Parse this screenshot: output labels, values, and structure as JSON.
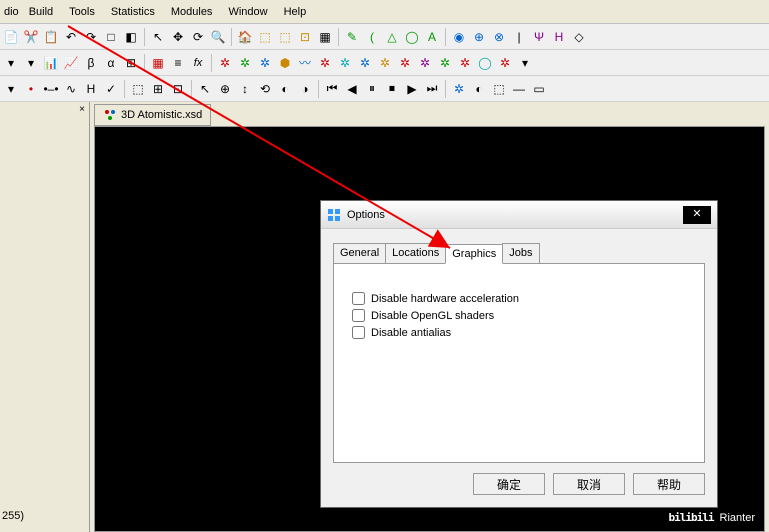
{
  "menubar": {
    "items": [
      "Build",
      "Tools",
      "Statistics",
      "Modules",
      "Window",
      "Help"
    ],
    "title_partial": "dio"
  },
  "document": {
    "tab_title": "3D Atomistic.xsd"
  },
  "sidebar": {
    "bottom_text": "255)"
  },
  "dialog": {
    "title": "Options",
    "tabs": [
      "General",
      "Locations",
      "Graphics",
      "Jobs"
    ],
    "active_tab": 2,
    "options": [
      {
        "label": "Disable hardware acceleration",
        "checked": false
      },
      {
        "label": "Disable OpenGL shaders",
        "checked": false
      },
      {
        "label": "Disable antialias",
        "checked": false
      }
    ],
    "buttons": {
      "ok": "确定",
      "cancel": "取消",
      "help": "帮助"
    }
  },
  "watermark": {
    "logo": "bilibili",
    "author": "Rianter"
  }
}
